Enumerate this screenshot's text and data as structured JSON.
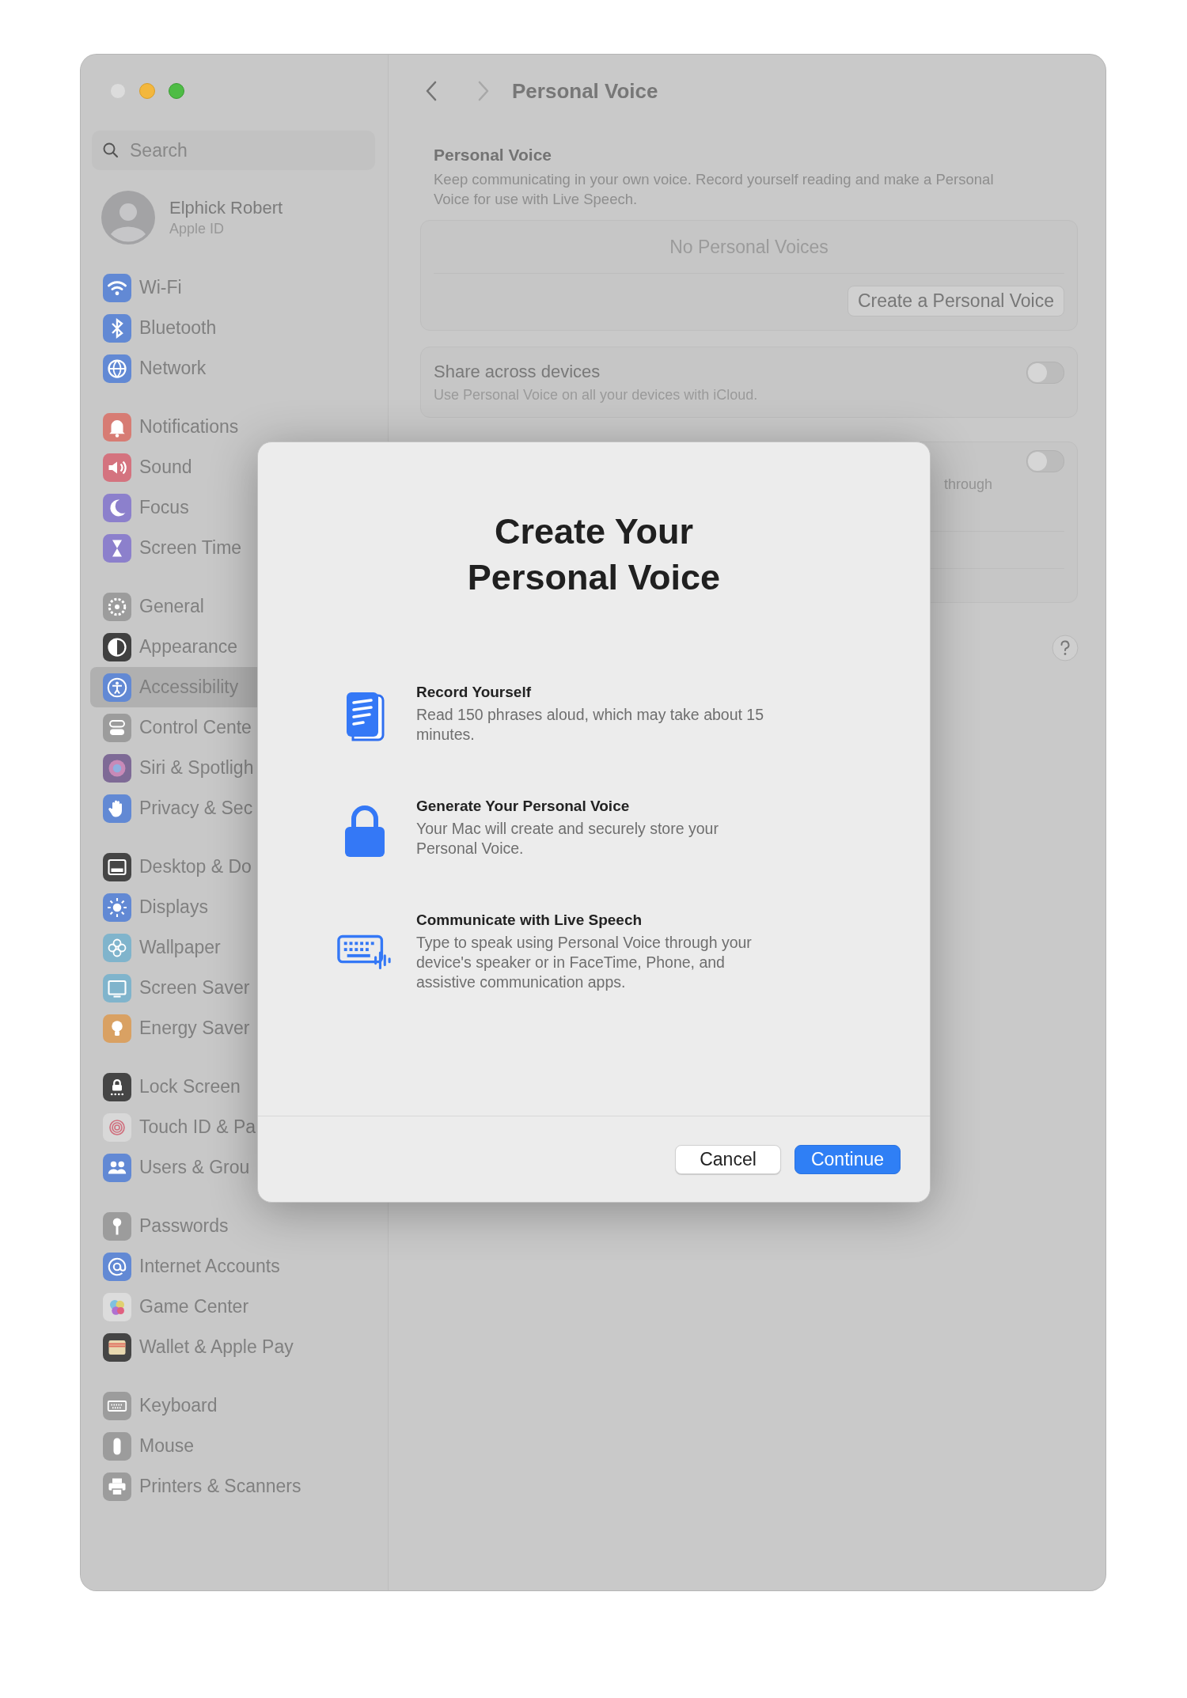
{
  "sidebar": {
    "search": {
      "placeholder": "Search"
    },
    "profile": {
      "name": "Elphick Robert",
      "subtitle": "Apple ID"
    },
    "groups": [
      {
        "items": [
          {
            "label": "Wi-Fi",
            "color": "#6289d4",
            "selected": false
          },
          {
            "label": "Bluetooth",
            "color": "#6289d4",
            "selected": false
          },
          {
            "label": "Network",
            "color": "#6289d4",
            "selected": false
          }
        ]
      },
      {
        "items": [
          {
            "label": "Notifications",
            "color": "#d77c74",
            "selected": false
          },
          {
            "label": "Sound",
            "color": "#d4737f",
            "selected": false
          },
          {
            "label": "Focus",
            "color": "#8c80cc",
            "selected": false
          },
          {
            "label": "Screen Time",
            "color": "#8c80cc",
            "selected": false
          }
        ]
      },
      {
        "items": [
          {
            "label": "General",
            "color": "#9c9c9c",
            "selected": false
          },
          {
            "label": "Appearance",
            "color": "#404040",
            "selected": false
          },
          {
            "label": "Accessibility",
            "color": "#6289d4",
            "selected": true
          },
          {
            "label": "Control Cente",
            "color": "#9c9c9c",
            "selected": false
          },
          {
            "label": "Siri & Spotligh",
            "color": "#7e6a96",
            "selected": false
          },
          {
            "label": "Privacy & Sec",
            "color": "#6289d4",
            "selected": false
          }
        ]
      },
      {
        "items": [
          {
            "label": "Desktop & Do",
            "color": "#454545",
            "selected": false
          },
          {
            "label": "Displays",
            "color": "#6289d4",
            "selected": false
          },
          {
            "label": "Wallpaper",
            "color": "#80b4cc",
            "selected": false
          },
          {
            "label": "Screen Saver",
            "color": "#80b4cc",
            "selected": false
          },
          {
            "label": "Energy Saver",
            "color": "#d9a163",
            "selected": false
          }
        ]
      },
      {
        "items": [
          {
            "label": "Lock Screen",
            "color": "#454545",
            "selected": false
          },
          {
            "label": "Touch ID & Pa",
            "color": "#d8d8d8",
            "selected": false
          },
          {
            "label": "Users & Grou",
            "color": "#6289d4",
            "selected": false
          }
        ]
      },
      {
        "items": [
          {
            "label": "Passwords",
            "color": "#9c9c9c",
            "selected": false
          },
          {
            "label": "Internet Accounts",
            "color": "#6289d4",
            "selected": false
          },
          {
            "label": "Game Center",
            "color": "#dcdcdc",
            "selected": false
          },
          {
            "label": "Wallet & Apple Pay",
            "color": "#454545",
            "selected": false
          }
        ]
      },
      {
        "items": [
          {
            "label": "Keyboard",
            "color": "#9c9c9c",
            "selected": false
          },
          {
            "label": "Mouse",
            "color": "#9c9c9c",
            "selected": false
          },
          {
            "label": "Printers & Scanners",
            "color": "#9c9c9c",
            "selected": false
          }
        ]
      }
    ]
  },
  "main": {
    "title": "Personal Voice",
    "section": {
      "title": "Personal Voice",
      "description": "Keep communicating in your own voice. Record yourself reading and make a Personal Voice for use with Live Speech."
    },
    "voices": {
      "empty": "No Personal Voices",
      "button": "Create a Personal Voice"
    },
    "share": {
      "title": "Share across devices",
      "description": "Use Personal Voice on all your devices with iCloud.",
      "on": false
    },
    "live_speech": {
      "description_fragment": "through",
      "on": false
    }
  },
  "dialog": {
    "title": "Create Your Personal Voice",
    "steps": [
      {
        "kind": "document",
        "title": "Record Yourself",
        "description": "Read 150 phrases aloud, which may take about 15 minutes."
      },
      {
        "kind": "lock",
        "title": "Generate Your Personal Voice",
        "description": "Your Mac will create and securely store your Personal Voice."
      },
      {
        "kind": "keyboard",
        "title": "Communicate with Live Speech",
        "description": "Type to speak using Personal Voice through your device's speaker or in FaceTime, Phone, and assistive communication apps."
      }
    ],
    "buttons": {
      "cancel": "Cancel",
      "continue": "Continue"
    }
  }
}
